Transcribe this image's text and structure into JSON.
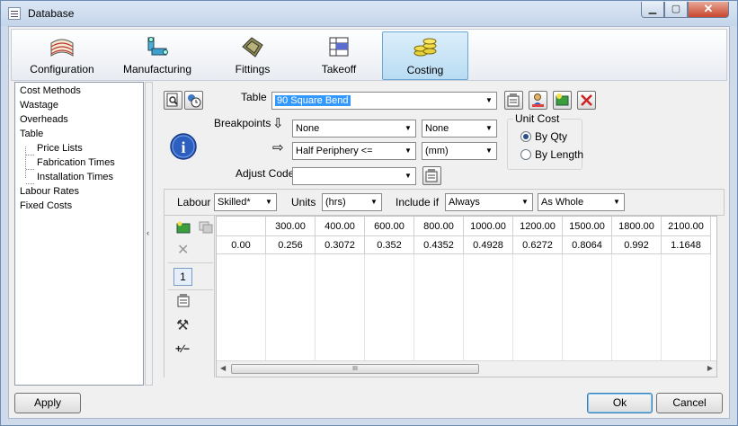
{
  "window": {
    "title": "Database",
    "min_glyph": "▁",
    "max_glyph": "▢",
    "close_glyph": "✕"
  },
  "ribbon": {
    "tabs": [
      {
        "label": "Configuration",
        "icon": "book-stack-icon"
      },
      {
        "label": "Manufacturing",
        "icon": "machine-icon"
      },
      {
        "label": "Fittings",
        "icon": "fitting-icon"
      },
      {
        "label": "Takeoff",
        "icon": "takeoff-icon"
      },
      {
        "label": "Costing",
        "icon": "coins-icon",
        "active": true
      }
    ]
  },
  "nav": {
    "items": [
      "Cost Methods",
      "Wastage",
      "Overheads",
      "Table",
      "Price Lists",
      "Fabrication Times",
      "Installation Times",
      "Labour Rates",
      "Fixed Costs"
    ]
  },
  "splitter_glyph": "‹",
  "form": {
    "table_label": "Table",
    "table_value": "90 Square Bend",
    "breakpoints_label": "Breakpoints",
    "bp1_value": "None",
    "bp1_unit": "None",
    "bp2_value": "Half Periphery <=",
    "bp2_unit": "(mm)",
    "adjust_label": "Adjust Code",
    "adjust_value": "",
    "arrow_down_glyph": "⇩",
    "arrow_right_glyph": "⇨",
    "combo_arrow": "▼",
    "info_glyph": "i"
  },
  "unit_cost": {
    "title": "Unit Cost",
    "options": [
      "By Qty",
      "By Length"
    ],
    "selected": "By Qty"
  },
  "labour_bar": {
    "labour_label": "Labour",
    "labour_value": "Skilled*",
    "units_label": "Units",
    "units_value": "(hrs)",
    "include_label": "Include if",
    "include_value": "Always",
    "whole_value": "As Whole"
  },
  "side_tools": {
    "one_label": "1",
    "delete_glyph": "✕",
    "plusminus_glyph": "+∕−",
    "hammer_glyph": "⚒"
  },
  "table": {
    "columns": [
      "300.00",
      "400.00",
      "600.00",
      "800.00",
      "1000.00",
      "1200.00",
      "1500.00",
      "1800.00",
      "2100.00"
    ],
    "rows": [
      {
        "label": "0.00",
        "values": [
          "0.256",
          "0.3072",
          "0.352",
          "0.4352",
          "0.4928",
          "0.6272",
          "0.8064",
          "0.992",
          "1.1648"
        ]
      }
    ],
    "scroll_left": "◀",
    "scroll_right": "▶",
    "scroll_grip": "III"
  },
  "footer": {
    "apply": "Apply",
    "ok": "Ok",
    "cancel": "Cancel"
  }
}
